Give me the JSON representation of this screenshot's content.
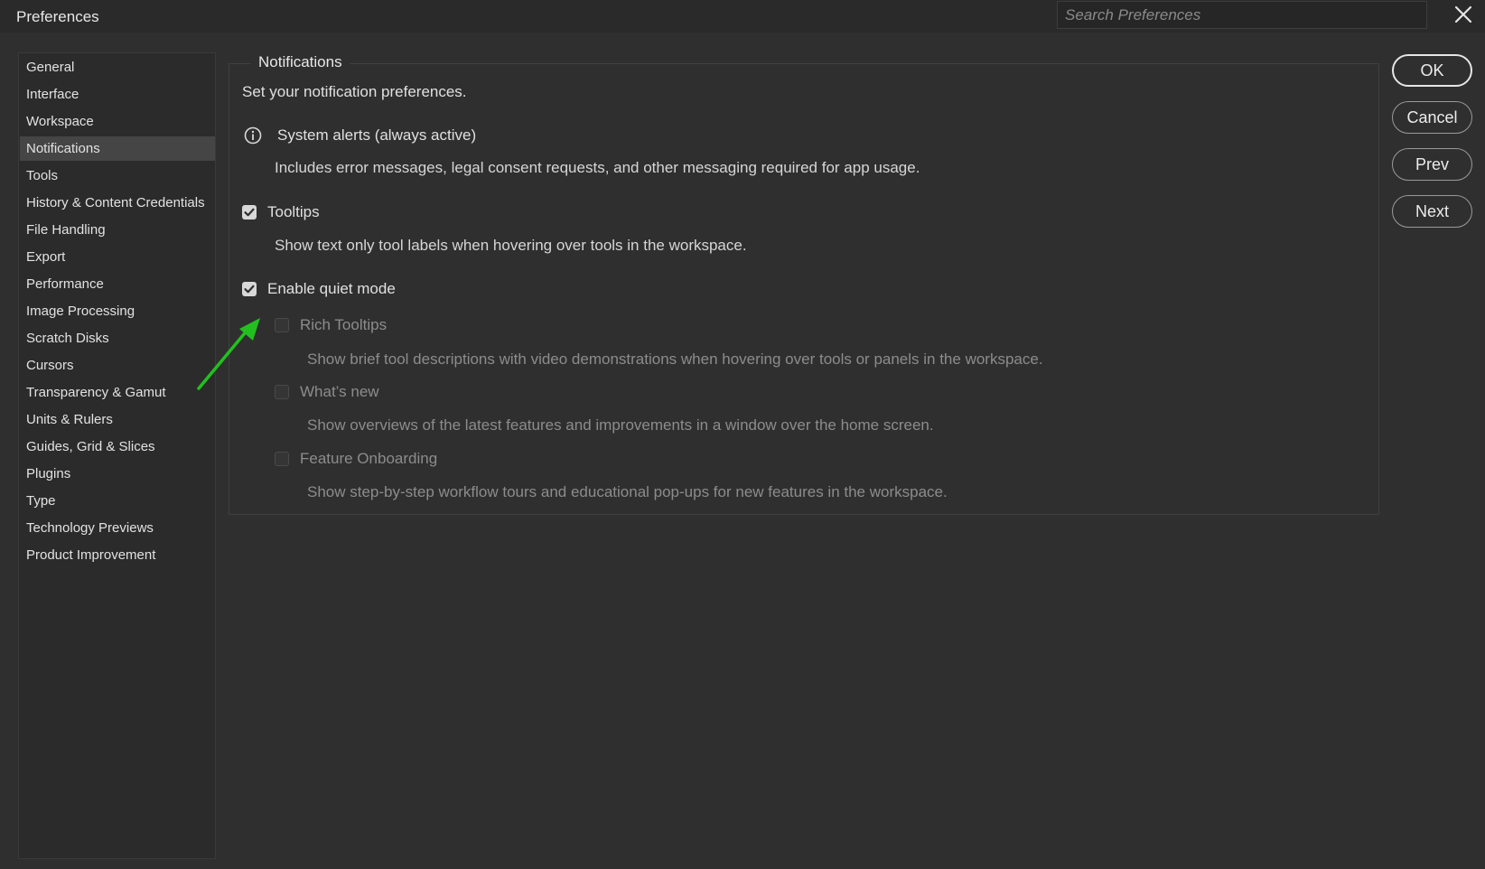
{
  "window": {
    "title": "Preferences"
  },
  "search": {
    "placeholder": "Search Preferences"
  },
  "sidebar": {
    "items": [
      {
        "label": "General"
      },
      {
        "label": "Interface"
      },
      {
        "label": "Workspace"
      },
      {
        "label": "Notifications",
        "selected": true
      },
      {
        "label": "Tools"
      },
      {
        "label": "History & Content Credentials"
      },
      {
        "label": "File Handling"
      },
      {
        "label": "Export"
      },
      {
        "label": "Performance"
      },
      {
        "label": "Image Processing"
      },
      {
        "label": "Scratch Disks"
      },
      {
        "label": "Cursors"
      },
      {
        "label": "Transparency & Gamut"
      },
      {
        "label": "Units & Rulers"
      },
      {
        "label": "Guides, Grid & Slices"
      },
      {
        "label": "Plugins"
      },
      {
        "label": "Type"
      },
      {
        "label": "Technology Previews"
      },
      {
        "label": "Product Improvement"
      }
    ]
  },
  "notifications": {
    "section_title": "Notifications",
    "intro": "Set your notification preferences.",
    "system_alerts": {
      "label": "System alerts (always active)",
      "description": "Includes error messages, legal consent requests, and other messaging required for app usage."
    },
    "tooltips": {
      "label": "Tooltips",
      "checked": true,
      "description": "Show text only tool labels when hovering over tools in the workspace."
    },
    "quiet_mode": {
      "label": "Enable quiet mode",
      "checked": true
    },
    "rich_tooltips": {
      "label": "Rich Tooltips",
      "checked": false,
      "disabled": true,
      "description": "Show brief tool descriptions with video demonstrations when hovering over tools or panels in the workspace."
    },
    "whats_new": {
      "label": "What’s new",
      "checked": false,
      "disabled": true,
      "description": "Show overviews of the latest features and improvements in a window over the home screen."
    },
    "feature_onboarding": {
      "label": "Feature Onboarding",
      "checked": false,
      "disabled": true,
      "description": "Show step-by-step workflow tours and educational pop-ups for new features in the workspace."
    }
  },
  "buttons": {
    "ok": "OK",
    "cancel": "Cancel",
    "prev": "Prev",
    "next": "Next"
  },
  "annotation": {
    "arrow_color": "#22c01e"
  }
}
